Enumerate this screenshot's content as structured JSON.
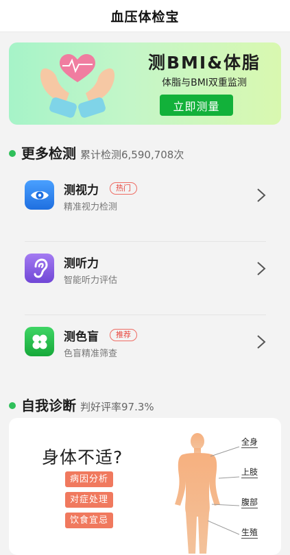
{
  "header": {
    "title": "血压体检宝"
  },
  "banner": {
    "title": "测BMI&体脂",
    "subtitle": "体脂与BMI双重监测",
    "button_label": "立即测量"
  },
  "more_tests": {
    "title": "更多检测",
    "meta": "累计检测6,590,708次",
    "items": [
      {
        "title": "测视力",
        "tag": "热门",
        "subtitle": "精准视力检测",
        "icon": "eye-icon",
        "color": "#2f86f0"
      },
      {
        "title": "测听力",
        "tag": "",
        "subtitle": "智能听力评估",
        "icon": "ear-icon",
        "color": "#8b63e6"
      },
      {
        "title": "测色盲",
        "tag": "推荐",
        "subtitle": "色盲精准筛查",
        "icon": "clover-icon",
        "color": "#24c24d"
      }
    ]
  },
  "self_diagnosis": {
    "title": "自我诊断",
    "meta": "判好评率97.3%",
    "card_title": "身体不适?",
    "buttons": [
      "病因分析",
      "对症处理",
      "饮食宜忌"
    ],
    "body_labels": [
      "全身",
      "上肢",
      "腹部",
      "生殖"
    ]
  },
  "colors": {
    "accent_green": "#12b13a",
    "tag_red": "#e8453c",
    "diag_orange": "#f0795e"
  }
}
